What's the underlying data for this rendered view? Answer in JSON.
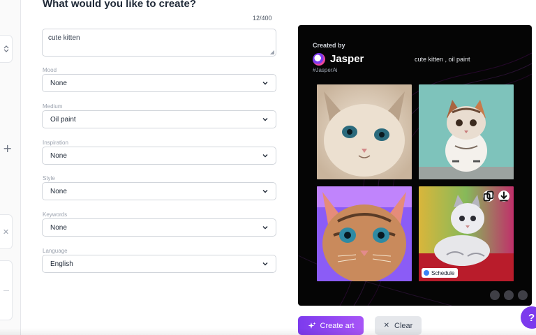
{
  "form": {
    "heading": "What would you like to create?",
    "char_count": "12/400",
    "prompt_value": "cute kitten",
    "fields": [
      {
        "label": "Mood",
        "value": "None"
      },
      {
        "label": "Medium",
        "value": "Oil paint"
      },
      {
        "label": "Inspiration",
        "value": "None"
      },
      {
        "label": "Style",
        "value": "None"
      },
      {
        "label": "Keywords",
        "value": "None"
      },
      {
        "label": "Language",
        "value": "English"
      }
    ]
  },
  "preview": {
    "created_by": "Created by",
    "brand": "Jasper",
    "hashtag": "#JasperAi",
    "caption": "cute kitten , oil paint",
    "schedule_label": "Schedule"
  },
  "actions": {
    "create_label": "Create art",
    "clear_label": "Clear",
    "help_label": "?"
  },
  "colors": {
    "accent": "#7c3aed",
    "card_bg": "#050505"
  }
}
